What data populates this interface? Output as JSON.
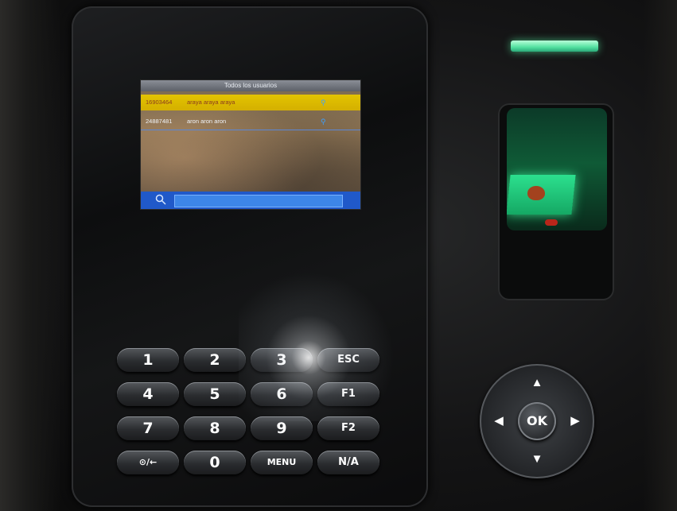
{
  "screen": {
    "title": "Todos los usuarios",
    "users": [
      {
        "id": "16903464",
        "name": "araya araya araya",
        "selected": true
      },
      {
        "id": "24887481",
        "name": "aron aron aron",
        "selected": false
      }
    ],
    "search_icon": "search-icon"
  },
  "keypad": {
    "keys": [
      "1",
      "2",
      "3",
      "ESC",
      "4",
      "5",
      "6",
      "F1",
      "7",
      "8",
      "9",
      "F2",
      "⊙/←",
      "0",
      "MENU",
      "N/A"
    ]
  },
  "navpad": {
    "up": "▲",
    "down": "▼",
    "left": "◀",
    "right": "▶",
    "ok": "OK"
  },
  "colors": {
    "selected_row": "#d4b000",
    "screen_accent": "#2059c9",
    "led": "#52e0a0",
    "reader_glow": "#2ce08e"
  }
}
